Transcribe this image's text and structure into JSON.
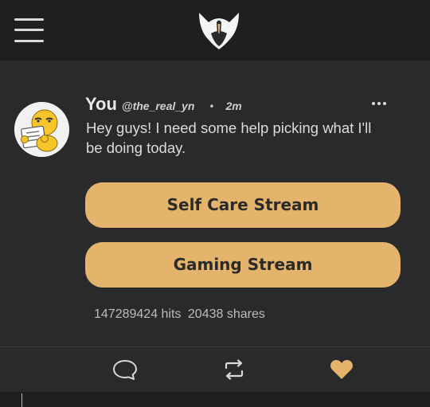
{
  "app": {
    "logo": "horned-mask-logo-icon",
    "accent_color": "#e5b46c",
    "background_color": "#2a2a2c",
    "bar_color": "#1f1f21"
  },
  "topbar": {
    "menu_icon": "hamburger-menu-icon"
  },
  "post": {
    "author_name": "You",
    "author_handle": "@the_real_yn",
    "separator": "•",
    "time": "2m",
    "text": "Hey guys! I need some help picking what I'll be doing today.",
    "more_icon": "more-horizontal-icon",
    "avatar": "avatar-emoji-reading-paper",
    "choices": [
      {
        "label": "Self Care Stream"
      },
      {
        "label": "Gaming Stream"
      }
    ],
    "stats": {
      "hits": "147289424 hits",
      "shares": "20438 shares"
    }
  },
  "actions": {
    "comment_icon": "comment-icon",
    "repost_icon": "repost-icon",
    "like_icon": "heart-icon"
  }
}
